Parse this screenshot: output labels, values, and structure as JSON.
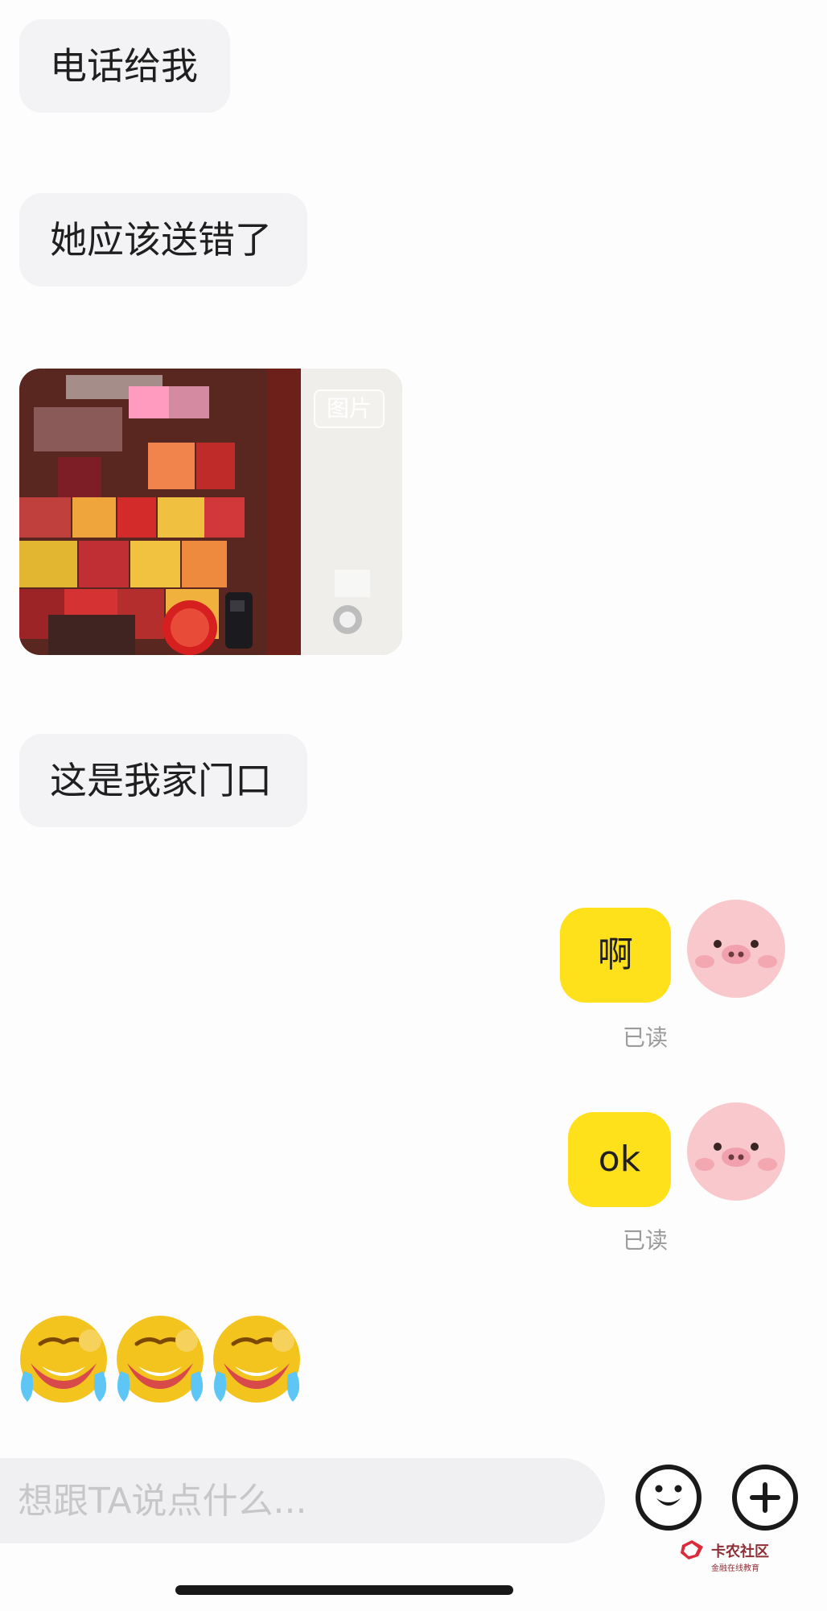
{
  "conversation": {
    "incoming_messages": [
      {
        "text": "电话给我"
      },
      {
        "text": "她应该送错了"
      },
      {
        "text": "这是我家门口"
      }
    ],
    "image_message": {
      "label": "图片"
    },
    "outgoing_messages": [
      {
        "text": "啊",
        "status": "已读"
      },
      {
        "text": "ok",
        "status": "已读"
      }
    ],
    "emoji_names": [
      "crying-laughing-emoji",
      "crying-laughing-emoji",
      "crying-laughing-emoji"
    ]
  },
  "composer": {
    "placeholder": "想跟TA说点什么..."
  },
  "watermark": {
    "title": "卡农社区",
    "subtitle": "金融在线教育"
  },
  "colors": {
    "incoming_bubble": "#f3f3f5",
    "outgoing_bubble": "#ffe11b",
    "avatar_pink": "#f8c8cc",
    "page_bg": "#fdfdfd"
  }
}
